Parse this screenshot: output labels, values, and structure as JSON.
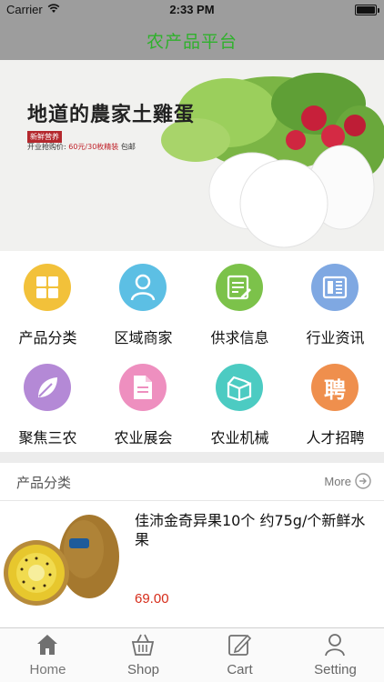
{
  "status_bar": {
    "carrier": "Carrier",
    "time": "2:33 PM"
  },
  "nav": {
    "title": "农产品平台"
  },
  "banner": {
    "headline": "地道的農家土雞蛋",
    "tag": "新鲜营养",
    "promo_prefix": "开业抢购价: ",
    "promo_price": "60元/30枚精装",
    "promo_suffix": " 包邮"
  },
  "categories": [
    {
      "label": "产品分类",
      "icon": "grid-icon",
      "color": "#f2c13a"
    },
    {
      "label": "区域商家",
      "icon": "person-icon",
      "color": "#5cbfe4"
    },
    {
      "label": "供求信息",
      "icon": "list-edit-icon",
      "color": "#7cc24a"
    },
    {
      "label": "行业资讯",
      "icon": "news-icon",
      "color": "#7fa8e2"
    },
    {
      "label": "聚焦三农",
      "icon": "leaf-icon",
      "color": "#b489d6"
    },
    {
      "label": "农业展会",
      "icon": "document-icon",
      "color": "#ee8fbf"
    },
    {
      "label": "农业机械",
      "icon": "box-icon",
      "color": "#4ccbc2"
    },
    {
      "label": "人才招聘",
      "icon": "recruit-icon",
      "color": "#ef8f4d"
    }
  ],
  "section": {
    "title": "产品分类",
    "more": "More"
  },
  "product": {
    "name": "佳沛金奇异果10个 约75g/个新鲜水果",
    "price": "69.00"
  },
  "tabs": [
    {
      "label": "Home",
      "icon": "home-icon",
      "active": true
    },
    {
      "label": "Shop",
      "icon": "basket-icon",
      "active": false
    },
    {
      "label": "Cart",
      "icon": "edit-icon",
      "active": false
    },
    {
      "label": "Setting",
      "icon": "user-icon",
      "active": false
    }
  ]
}
